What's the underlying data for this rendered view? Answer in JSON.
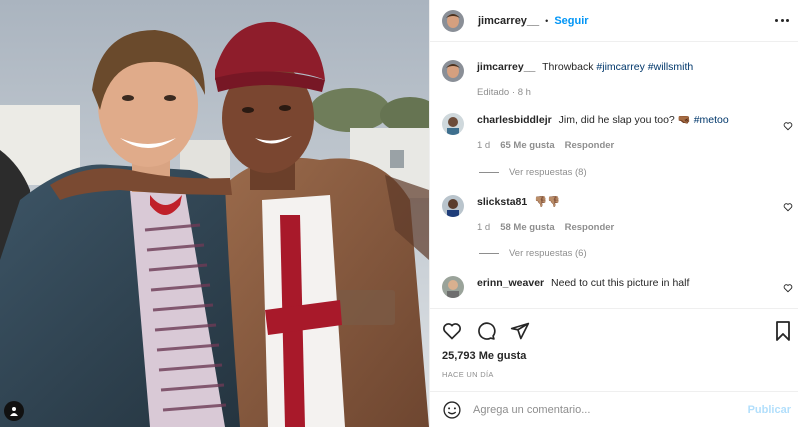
{
  "post": {
    "username": "jimcarrey__",
    "separator": "•",
    "follow_label": "Seguir",
    "caption_text": "Throwback",
    "caption_tags": [
      "#jimcarrey",
      "#willsmith"
    ],
    "edited_label": "Editado",
    "edited_age": "8 h",
    "likes": "25,793 Me gusta",
    "timestamp": "HACE UN DÍA"
  },
  "comments": [
    {
      "username": "charlesbiddlejr",
      "text": "Jim, did he slap you too?",
      "emoji": "🤜🏾",
      "tag": "#metoo",
      "age": "1 d",
      "likes": "65 Me gusta",
      "reply_label": "Responder",
      "view_replies": "Ver respuestas (8)"
    },
    {
      "username": "slicksta81",
      "text": "👎🏽👎🏽",
      "age": "1 d",
      "likes": "58 Me gusta",
      "reply_label": "Responder",
      "view_replies": "Ver respuestas (6)"
    },
    {
      "username": "erinn_weaver",
      "text": "Need to cut this picture in half"
    }
  ],
  "composer": {
    "placeholder": "Agrega un comentario...",
    "publish_label": "Publicar"
  },
  "colors": {
    "accent": "#0095f6",
    "hashtag": "#00376b",
    "muted": "#8e8e8e",
    "publish_disabled": "#b2dffc"
  },
  "icons": [
    "more-options-icon",
    "heart-icon",
    "comment-icon",
    "share-icon",
    "bookmark-icon",
    "emoji-icon",
    "user-tag-icon"
  ]
}
